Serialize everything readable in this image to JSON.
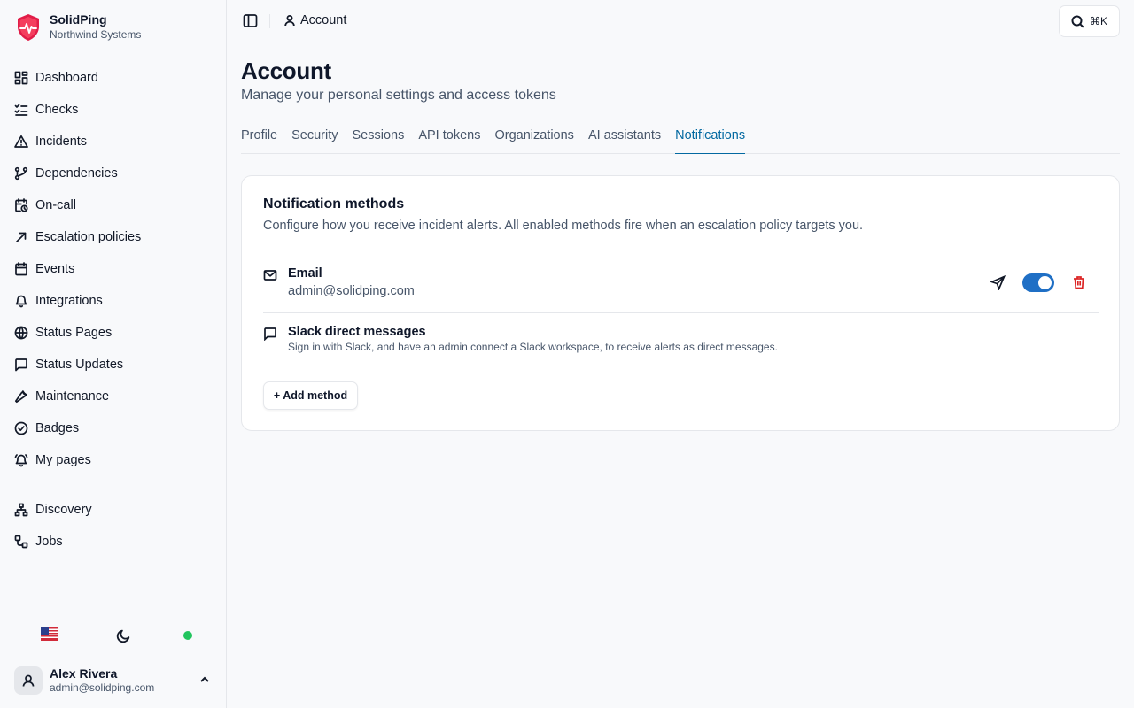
{
  "brand": {
    "name": "SolidPing",
    "org": "Northwind Systems",
    "logo_color": "#e11d48"
  },
  "sidebar": {
    "items": [
      {
        "label": "Dashboard",
        "icon": "dashboard-icon"
      },
      {
        "label": "Checks",
        "icon": "list-checks-icon"
      },
      {
        "label": "Incidents",
        "icon": "warning-triangle-icon"
      },
      {
        "label": "Dependencies",
        "icon": "git-branch-icon"
      },
      {
        "label": "On-call",
        "icon": "calendar-clock-icon"
      },
      {
        "label": "Escalation policies",
        "icon": "arrow-up-right-icon"
      },
      {
        "label": "Events",
        "icon": "calendar-icon"
      },
      {
        "label": "Integrations",
        "icon": "bell-icon"
      },
      {
        "label": "Status Pages",
        "icon": "globe-icon"
      },
      {
        "label": "Status Updates",
        "icon": "message-square-icon"
      },
      {
        "label": "Maintenance",
        "icon": "wrench-icon"
      },
      {
        "label": "Badges",
        "icon": "check-circle-icon"
      },
      {
        "label": "My pages",
        "icon": "bell-ring-icon"
      }
    ],
    "secondary": [
      {
        "label": "Discovery",
        "icon": "network-icon"
      },
      {
        "label": "Jobs",
        "icon": "workflow-icon"
      }
    ],
    "footer": {
      "flag": "🇺🇸",
      "status_color": "#22c55e"
    },
    "user": {
      "name": "Alex Rivera",
      "email": "admin@solidping.com"
    }
  },
  "topbar": {
    "breadcrumb": "Account",
    "search_shortcut": "⌘K"
  },
  "page": {
    "title": "Account",
    "subtitle": "Manage your personal settings and access tokens",
    "tabs": [
      {
        "label": "Profile"
      },
      {
        "label": "Security"
      },
      {
        "label": "Sessions"
      },
      {
        "label": "API tokens"
      },
      {
        "label": "Organizations"
      },
      {
        "label": "AI assistants"
      },
      {
        "label": "Notifications",
        "active": true
      }
    ]
  },
  "card": {
    "title": "Notification methods",
    "description": "Configure how you receive incident alerts. All enabled methods fire when an escalation policy targets you.",
    "methods": [
      {
        "name": "Email",
        "value": "admin@solidping.com",
        "enabled": true,
        "toggle_color": "#1f6fc5"
      },
      {
        "name": "Slack direct messages",
        "description": "Sign in with Slack, and have an admin connect a Slack workspace, to receive alerts as direct messages."
      }
    ],
    "add_label": "+ Add method"
  }
}
